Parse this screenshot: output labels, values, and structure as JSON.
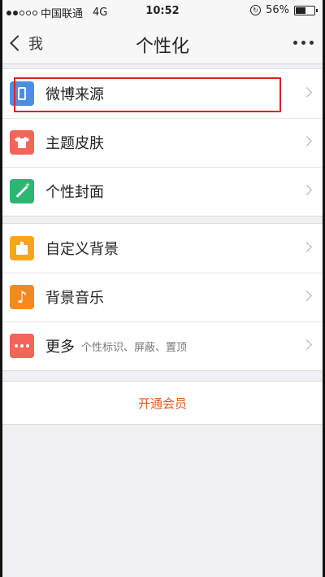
{
  "status_bar": {
    "carrier": "中国联通",
    "network": "4G",
    "time": "10:52",
    "battery_percent": "56%",
    "battery_level": 0.56,
    "signal_bars_filled": 2,
    "signal_bars_total": 5
  },
  "nav": {
    "back_label": "我",
    "title": "个性化"
  },
  "groups": [
    {
      "items": [
        {
          "label": "微博来源",
          "icon": "phone-icon",
          "color": "#4a8fe2",
          "highlighted": true
        },
        {
          "label": "主题皮肤",
          "icon": "shirt-icon",
          "color": "#f2665a"
        },
        {
          "label": "个性封面",
          "icon": "magic-wand-icon",
          "color": "#2bb673"
        }
      ]
    },
    {
      "items": [
        {
          "label": "自定义背景",
          "icon": "easel-icon",
          "color": "#f8a51c"
        },
        {
          "label": "背景音乐",
          "icon": "music-note-icon",
          "color": "#f48a1f"
        },
        {
          "label": "更多",
          "sublabel": "个性标识、屏蔽、置顶",
          "icon": "more-icon",
          "color": "#f2665a"
        }
      ]
    }
  ],
  "member_button": {
    "label": "开通会员",
    "color": "#e8541d"
  },
  "highlight_color": "#e0202a"
}
